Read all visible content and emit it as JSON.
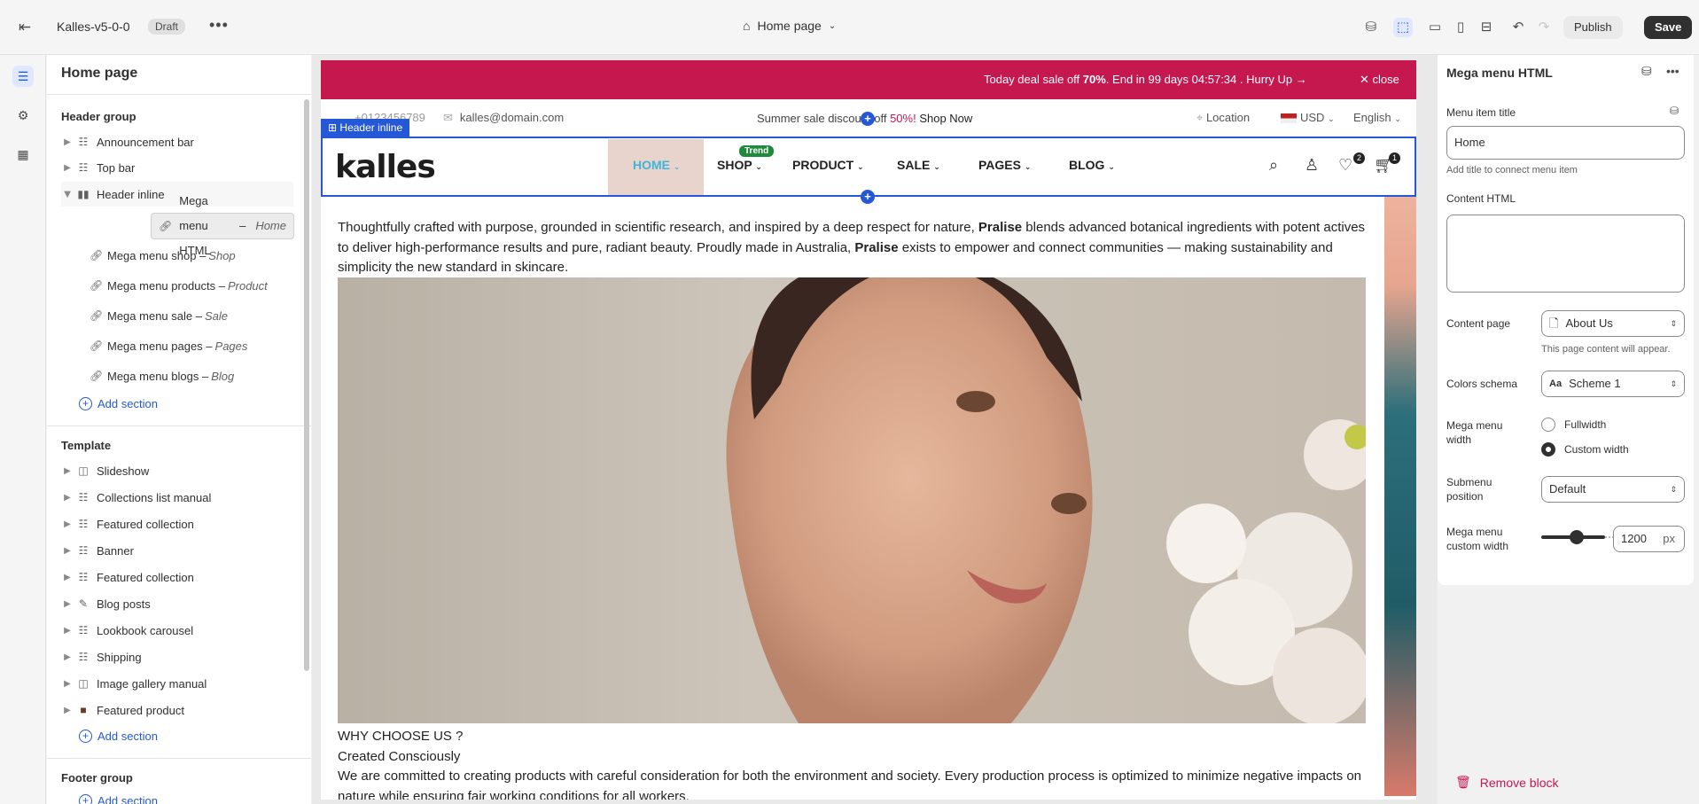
{
  "topbar": {
    "theme_name": "Kalles-v5-0-0",
    "status_badge": "Draft",
    "page_selector": "Home page",
    "publish_label": "Publish",
    "save_label": "Save"
  },
  "sidebar": {
    "title": "Home page",
    "header_group_label": "Header group",
    "header_items": [
      "Announcement bar",
      "Top bar",
      "Header inline"
    ],
    "header_inline_blocks": [
      {
        "label": "Mega menu HTML",
        "sub": "Home"
      },
      {
        "label": "Mega menu shop",
        "sub": "Shop"
      },
      {
        "label": "Mega menu products",
        "sub": "Product"
      },
      {
        "label": "Mega menu sale",
        "sub": "Sale"
      },
      {
        "label": "Mega menu pages",
        "sub": "Pages"
      },
      {
        "label": "Mega menu blogs",
        "sub": "Blog"
      }
    ],
    "add_section_label": "Add section",
    "template_label": "Template",
    "template_items": [
      "Slideshow",
      "Collections list manual",
      "Featured collection",
      "Banner",
      "Featured collection",
      "Blog posts",
      "Lookbook carousel",
      "Shipping",
      "Image gallery manual",
      "Featured product"
    ],
    "footer_group_label": "Footer group"
  },
  "preview": {
    "announcement": {
      "text_pre": "Today deal sale off ",
      "text_bold": "70%",
      "text_post": ". End in 99 days 04:57:34 .  Hurry Up →",
      "close": "✕ close"
    },
    "topbar": {
      "phone": "+0123456789",
      "email": "kalles@domain.com",
      "sale_pre": "Summer sale discount off ",
      "sale_red": "50%!",
      "sale_link": " Shop Now",
      "location": "Location",
      "currency": "USD",
      "language": "English"
    },
    "header_label": "Header inline",
    "logo": "kalles",
    "nav": [
      {
        "label": "HOME"
      },
      {
        "label": "SHOP"
      },
      {
        "label": "PRODUCT"
      },
      {
        "label": "SALE"
      },
      {
        "label": "PAGES"
      },
      {
        "label": "BLOG"
      }
    ],
    "trend_badge": "Trend",
    "wishlist_count": "2",
    "cart_count": "1",
    "intro_1": "Thoughtfully crafted with purpose, grounded in scientific research, and inspired by a deep respect for nature, ",
    "brand": "Pralise",
    "intro_2": " blends advanced botanical ingredients with potent actives to deliver high-performance results and pure, radiant beauty. Proudly made in Australia, ",
    "intro_3": " exists to empower and connect communities — making sustainability and simplicity the new standard in skincare.",
    "why": "WHY CHOOSE US ?",
    "created": "Created Consciously",
    "body": "We are committed to creating products with careful consideration for both the environment and society. Every production process is optimized to minimize negative impacts on nature while ensuring fair working conditions for all workers."
  },
  "panel": {
    "title": "Mega menu HTML",
    "menu_item_title_label": "Menu item title",
    "menu_item_title_value": "Home",
    "menu_item_title_hint": "Add title to connect menu item",
    "content_html_label": "Content HTML",
    "content_page_label": "Content page",
    "content_page_value": "About Us",
    "content_page_hint": "This page content will appear.",
    "colors_label": "Colors schema",
    "colors_value": "Scheme 1",
    "width_label": "Mega menu width",
    "width_options": [
      "Fullwidth",
      "Custom width"
    ],
    "width_selected": "Custom width",
    "submenu_label": "Submenu position",
    "submenu_value": "Default",
    "custom_width_label": "Mega menu custom width",
    "custom_width_value": "1200",
    "custom_width_unit": "px",
    "remove_label": "Remove block"
  }
}
